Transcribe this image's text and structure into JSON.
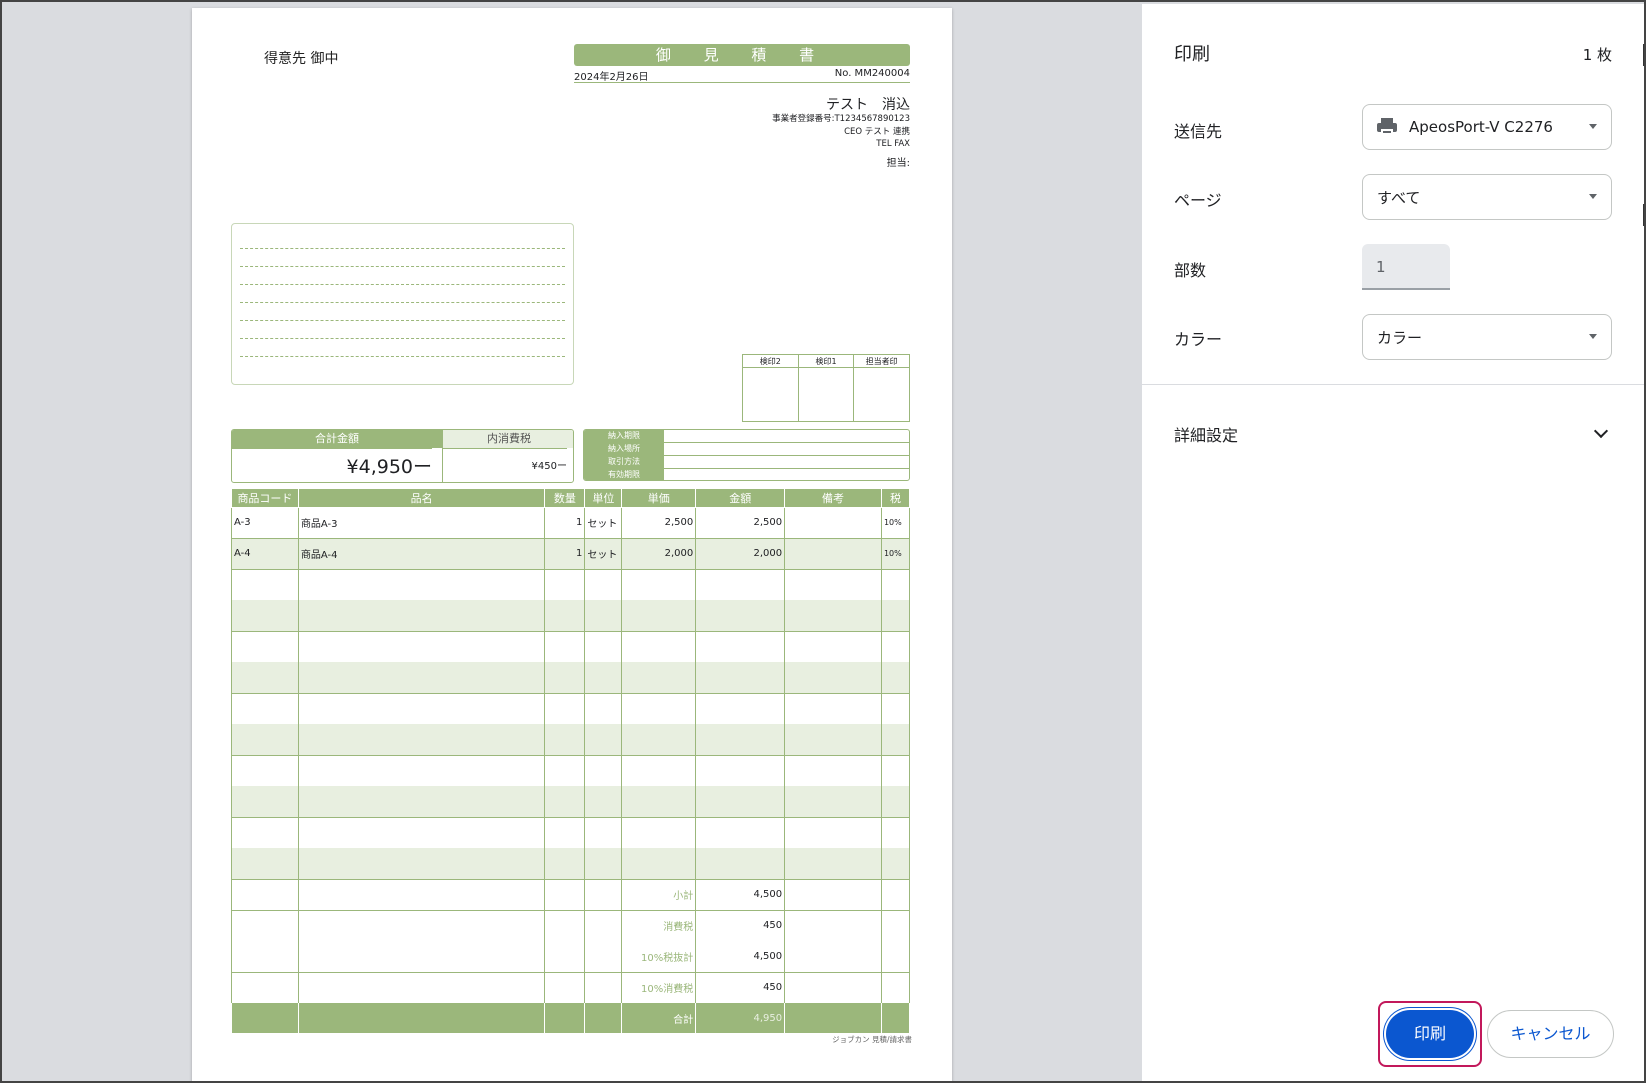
{
  "document": {
    "client": "得意先 御中",
    "title": "御 見 積 書",
    "date": "2024年2月26日",
    "doc_no": "No. MM240004",
    "company": "テスト　消込",
    "registration": "事業者登録番号:T1234567890123",
    "ceo": "CEO テスト 連携",
    "tel_fax": "TEL FAX",
    "person": "担当:",
    "stamps": [
      "検印2",
      "検印1",
      "担当者印"
    ],
    "total_label": "合計金額",
    "total_value": "¥4,950ー",
    "tax_label": "内消費税",
    "tax_value": "¥450ー",
    "delivery_rows": [
      "納入期限",
      "納入場所",
      "取引方法",
      "有効期限"
    ],
    "columns": [
      "商品コード",
      "品名",
      "数量",
      "単位",
      "単価",
      "金額",
      "備考",
      "税"
    ],
    "items": [
      {
        "code": "A-3",
        "name": "商品A-3",
        "qty": "1",
        "unit": "セット",
        "price": "2,500",
        "amount": "2,500",
        "note": "",
        "tax": "10%"
      },
      {
        "code": "A-4",
        "name": "商品A-4",
        "qty": "1",
        "unit": "セット",
        "price": "2,000",
        "amount": "2,000",
        "note": "",
        "tax": "10%"
      }
    ],
    "summary": {
      "subtotal_label": "小計",
      "subtotal": "4,500",
      "tax_label": "消費税",
      "tax": "450",
      "taxable_label": "10%税抜計",
      "taxable": "4,500",
      "tax10_label": "10%消費税",
      "tax10": "450",
      "total_label": "合計",
      "total": "4,950"
    },
    "footer_note": "ジョブカン 見積/請求書"
  },
  "panel": {
    "title": "印刷",
    "sheets": "1 枚",
    "destination_label": "送信先",
    "destination_value": "ApeosPort-V C2276",
    "pages_label": "ページ",
    "pages_value": "すべて",
    "copies_label": "部数",
    "copies_value": "1",
    "color_label": "カラー",
    "color_value": "カラー",
    "advanced_label": "詳細設定",
    "print_label": "印刷",
    "cancel_label": "キャンセル"
  },
  "colors": {
    "accent": "#9bb77b",
    "primary_button": "#0b57d0",
    "highlight_ring": "#c2185b"
  }
}
